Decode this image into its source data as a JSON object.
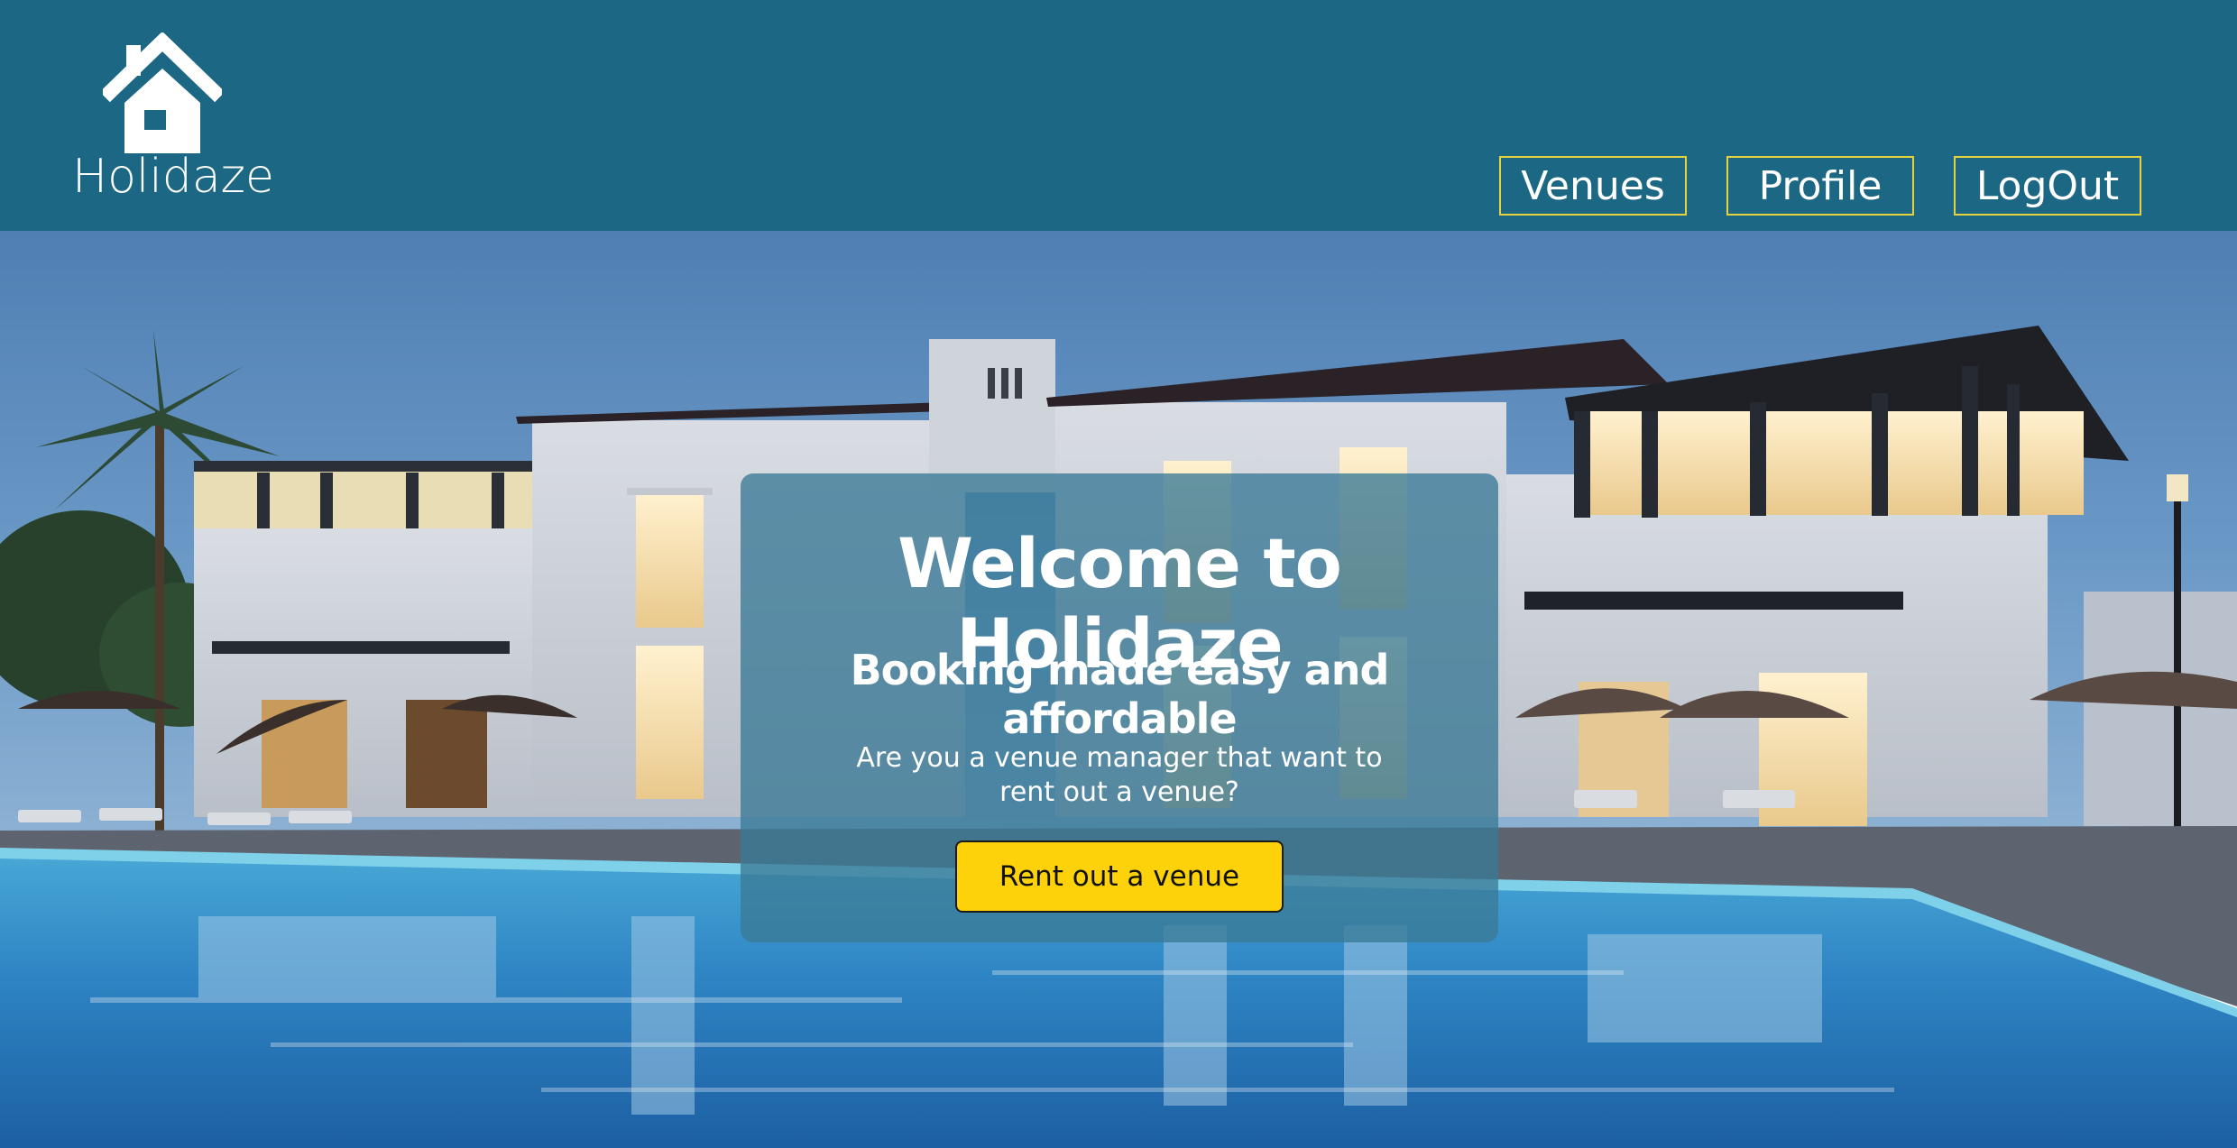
{
  "header": {
    "brand": "Holidaze",
    "logo_icon": "house-icon",
    "nav": {
      "venues": "Venues",
      "profile": "Profile",
      "logout": "LogOut"
    }
  },
  "hero": {
    "background": "resort-pool-photo",
    "title": "Welcome to Holidaze",
    "subtitle": "Booking made easy and affordable",
    "question": "Are you a venue manager that want to rent out a venue?",
    "cta_label": "Rent out a venue"
  },
  "colors": {
    "header_bg": "#1b6784",
    "nav_border": "#e7d23a",
    "cta_bg": "#fdd20a",
    "overlay": "rgba(58,122,150,0.78)"
  }
}
